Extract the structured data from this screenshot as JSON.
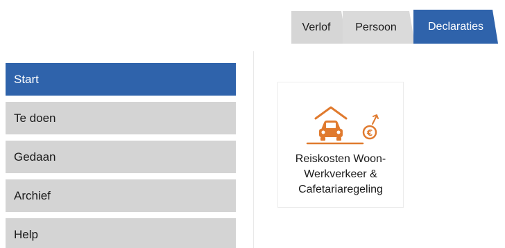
{
  "tabs": [
    {
      "label": "Verlof",
      "active": false
    },
    {
      "label": "Persoon",
      "active": false
    },
    {
      "label": "Declaraties",
      "active": true
    }
  ],
  "nav": {
    "items": [
      {
        "label": "Start",
        "active": true
      },
      {
        "label": "Te doen",
        "active": false
      },
      {
        "label": "Gedaan",
        "active": false
      },
      {
        "label": "Archief",
        "active": false
      },
      {
        "label": "Help",
        "active": false
      }
    ]
  },
  "tile": {
    "icon": "car-garage-euro-icon",
    "label_lines": [
      "Reiskosten Woon-",
      "Werkverkeer &",
      "Cafetariaregeling"
    ]
  },
  "colors": {
    "accent": "#2f63ab",
    "nav_bg": "#d4d4d4",
    "tab_bg": "#d6d6d6",
    "icon_orange": "#e07a2e"
  }
}
